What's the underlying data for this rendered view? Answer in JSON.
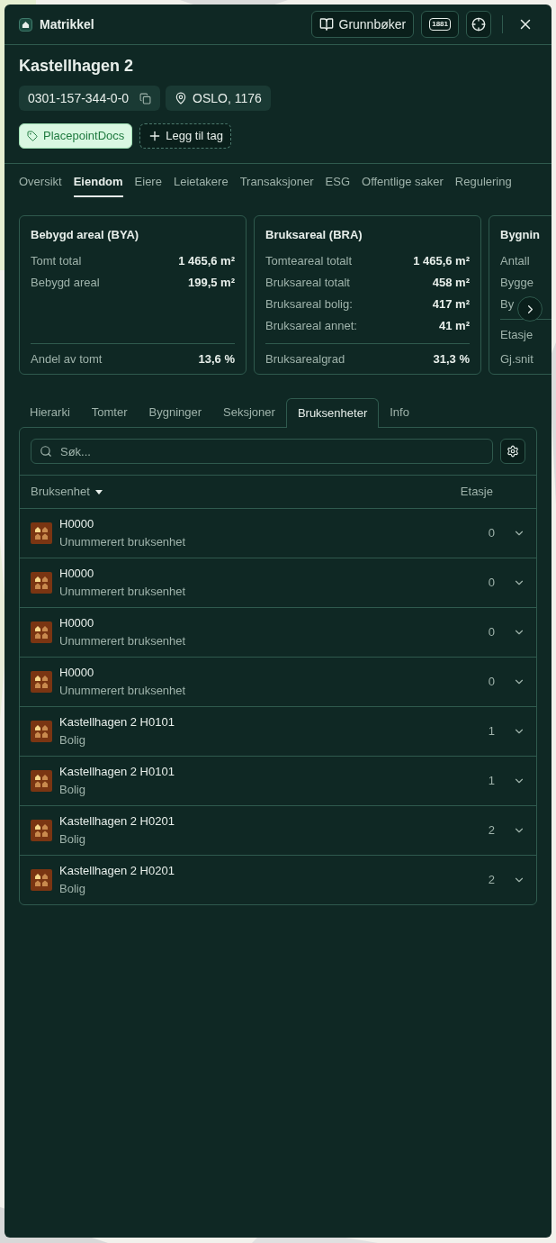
{
  "header": {
    "title": "Matrikkel",
    "buttons": [
      {
        "kind": "book",
        "label": "Grunnbøker"
      },
      {
        "kind": "badge",
        "label": "1881"
      },
      {
        "kind": "target"
      }
    ]
  },
  "property": {
    "name": "Kastellhagen 2",
    "id": "0301-157-344-0-0",
    "location": "OSLO, 1176"
  },
  "tags": [
    {
      "label": "PlacepointDocs"
    }
  ],
  "add_tag": "Legg til tag",
  "tabs": [
    {
      "label": "Oversikt",
      "selected": false
    },
    {
      "label": "Eiendom",
      "selected": true
    },
    {
      "label": "Eiere",
      "selected": false
    },
    {
      "label": "Leietakere",
      "selected": false
    },
    {
      "label": "Transaksjoner",
      "selected": false
    },
    {
      "label": "ESG",
      "selected": false
    },
    {
      "label": "Offentlige saker",
      "selected": false
    },
    {
      "label": "Regulering",
      "selected": false
    }
  ],
  "cards": [
    {
      "title": "Bebygd areal (BYA)",
      "rows": [
        {
          "label": "Tomt total",
          "value": "1 465,6 m²"
        },
        {
          "label": "Bebygd areal",
          "value": "199,5 m²"
        }
      ],
      "footer": [
        {
          "label": "Andel av tomt",
          "value": "13,6 %"
        }
      ]
    },
    {
      "title": "Bruksareal (BRA)",
      "rows": [
        {
          "label": "Tomteareal totalt",
          "value": "1 465,6 m²"
        },
        {
          "label": "Bruksareal totalt",
          "value": "458 m²"
        },
        {
          "label": "Bruksareal bolig:",
          "value": "417 m²"
        },
        {
          "label": "Bruksareal annet:",
          "value": "41 m²"
        }
      ],
      "footer": [
        {
          "label": "Bruksarealgrad",
          "value": "31,3 %"
        }
      ]
    },
    {
      "title": "Bygnin",
      "rows": [
        {
          "label": "Antall"
        },
        {
          "label": "Bygge"
        },
        {
          "label": "By"
        }
      ],
      "footer": [
        {
          "label": "Etasje"
        },
        {
          "label": "Gj.snit"
        }
      ]
    }
  ],
  "subtabs": [
    {
      "label": "Hierarki",
      "selected": false
    },
    {
      "label": "Tomter",
      "selected": false
    },
    {
      "label": "Bygninger",
      "selected": false
    },
    {
      "label": "Seksjoner",
      "selected": false
    },
    {
      "label": "Bruksenheter",
      "selected": true
    },
    {
      "label": "Info",
      "selected": false
    }
  ],
  "search": {
    "placeholder": "Søk..."
  },
  "table": {
    "columns": [
      "Bruksenhet",
      "Etasje"
    ],
    "rows": [
      {
        "name": "H0000",
        "type": "Unummerert bruksenhet",
        "floor": "0",
        "expanded": false
      },
      {
        "name": "H0000",
        "type": "Unummerert bruksenhet",
        "floor": "0",
        "expanded": false
      },
      {
        "name": "H0000",
        "type": "Unummerert bruksenhet",
        "floor": "0",
        "expanded": false
      },
      {
        "name": "H0000",
        "type": "Unummerert bruksenhet",
        "floor": "0",
        "expanded": false
      },
      {
        "name": "Kastellhagen 2 H0101",
        "type": "Bolig",
        "floor": "1",
        "expanded": false
      },
      {
        "name": "Kastellhagen 2 H0101",
        "type": "Bolig",
        "floor": "1",
        "expanded": false
      },
      {
        "name": "Kastellhagen 2 H0201",
        "type": "Bolig",
        "floor": "2",
        "expanded": false
      },
      {
        "name": "Kastellhagen 2 H0201",
        "type": "Bolig",
        "floor": "2",
        "expanded": false
      }
    ]
  }
}
